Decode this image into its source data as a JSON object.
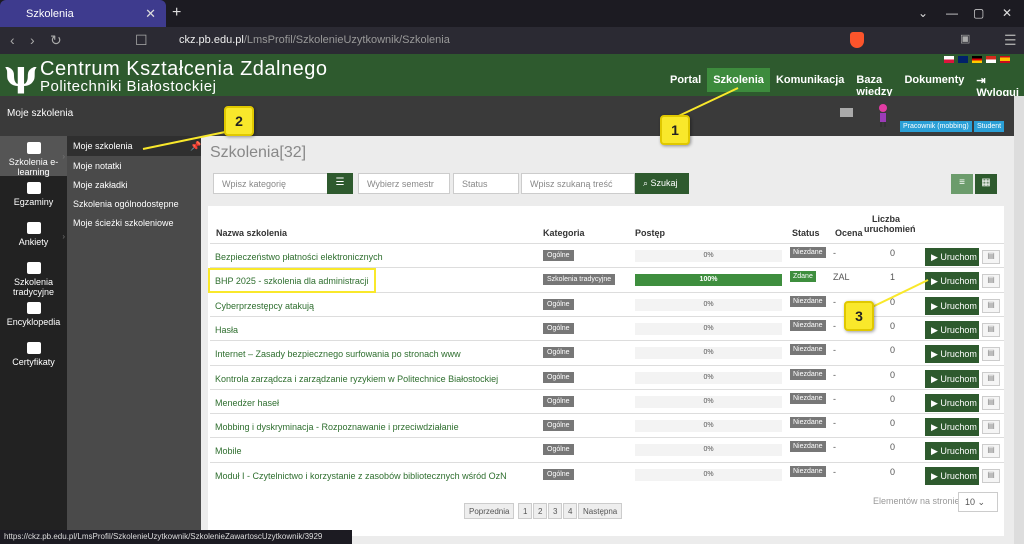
{
  "browser": {
    "tab_title": "Szkolenia",
    "url_host": "ckz.pb.edu.pl",
    "url_path": "/LmsProfil/SzkolenieUzytkownik/Szkolenia"
  },
  "header": {
    "logo_line1": "Centrum Kształcenia Zdalnego",
    "logo_line2": "Politechniki Białostockiej",
    "nav": [
      "Portal",
      "Szkolenia",
      "Komunikacja",
      "Baza wiedzy",
      "Dokumenty",
      "Wyloguj"
    ],
    "page": "Moje szkolenia",
    "badge1": "Pracownik (mobbing)",
    "badge2": "Student"
  },
  "leftnav": [
    "Szkolenia e-learning",
    "Egzaminy",
    "Ankiety",
    "Szkolenia tradycyjne",
    "Encyklopedia",
    "Certyfikaty"
  ],
  "subnav": [
    "Moje szkolenia",
    "Moje notatki",
    "Moje zakładki",
    "Szkolenia ogólnodostępne",
    "Moje ścieżki szkoleniowe"
  ],
  "main": {
    "title": "Szkolenia[32]",
    "f_category": "Wpisz kategorię",
    "f_semester": "Wybierz semestr",
    "f_status": "Status",
    "f_search": "Wpisz szukaną treść",
    "search_btn": "Szukaj"
  },
  "table": {
    "headers": [
      "Nazwa szkolenia",
      "Kategoria",
      "Postęp",
      "Status",
      "Ocena",
      "Liczba uruchomień"
    ],
    "rows": [
      {
        "name": "Bezpieczeństwo płatności elektronicznych",
        "cat": "Ogólne",
        "prog": "0%",
        "status": "Niezdane",
        "grade": "-",
        "cnt": "0"
      },
      {
        "name": "BHP 2025 - szkolenia dla administracji",
        "cat": "Szkolenia tradycyjne",
        "prog": "100%",
        "status": "Zdane",
        "grade": "ZAL",
        "cnt": "1"
      },
      {
        "name": "Cyberprzestępcy atakują",
        "cat": "Ogólne",
        "prog": "0%",
        "status": "Niezdane",
        "grade": "-",
        "cnt": "0"
      },
      {
        "name": "Hasła",
        "cat": "Ogólne",
        "prog": "0%",
        "status": "Niezdane",
        "grade": "-",
        "cnt": "0"
      },
      {
        "name": "Internet – Zasady bezpiecznego surfowania po stronach www",
        "cat": "Ogólne",
        "prog": "0%",
        "status": "Niezdane",
        "grade": "-",
        "cnt": "0"
      },
      {
        "name": "Kontrola zarządcza i zarządzanie ryzykiem w Politechnice Białostockiej",
        "cat": "Ogólne",
        "prog": "0%",
        "status": "Niezdane",
        "grade": "-",
        "cnt": "0"
      },
      {
        "name": "Menedżer haseł",
        "cat": "Ogólne",
        "prog": "0%",
        "status": "Niezdane",
        "grade": "-",
        "cnt": "0"
      },
      {
        "name": "Mobbing i dyskryminacja - Rozpoznawanie i przeciwdziałanie",
        "cat": "Ogólne",
        "prog": "0%",
        "status": "Niezdane",
        "grade": "-",
        "cnt": "0"
      },
      {
        "name": "Mobile",
        "cat": "Ogólne",
        "prog": "0%",
        "status": "Niezdane",
        "grade": "-",
        "cnt": "0"
      },
      {
        "name": "Moduł I - Czytelnictwo i korzystanie z zasobów bibliotecznych wśród OzN",
        "cat": "Ogólne",
        "prog": "0%",
        "status": "Niezdane",
        "grade": "-",
        "cnt": "0"
      }
    ],
    "run_label": "Uruchom"
  },
  "pagination": [
    "Poprzednia",
    "1",
    "2",
    "3",
    "4",
    "Następna"
  ],
  "per_page_label": "Elementów na stronie:",
  "per_page": "10",
  "status_url": "https://ckz.pb.edu.pl/LmsProfil/SzkolenieUzytkownik/SzkolenieZawartoscUzytkownik/3929",
  "callouts": [
    "1",
    "2",
    "3"
  ]
}
